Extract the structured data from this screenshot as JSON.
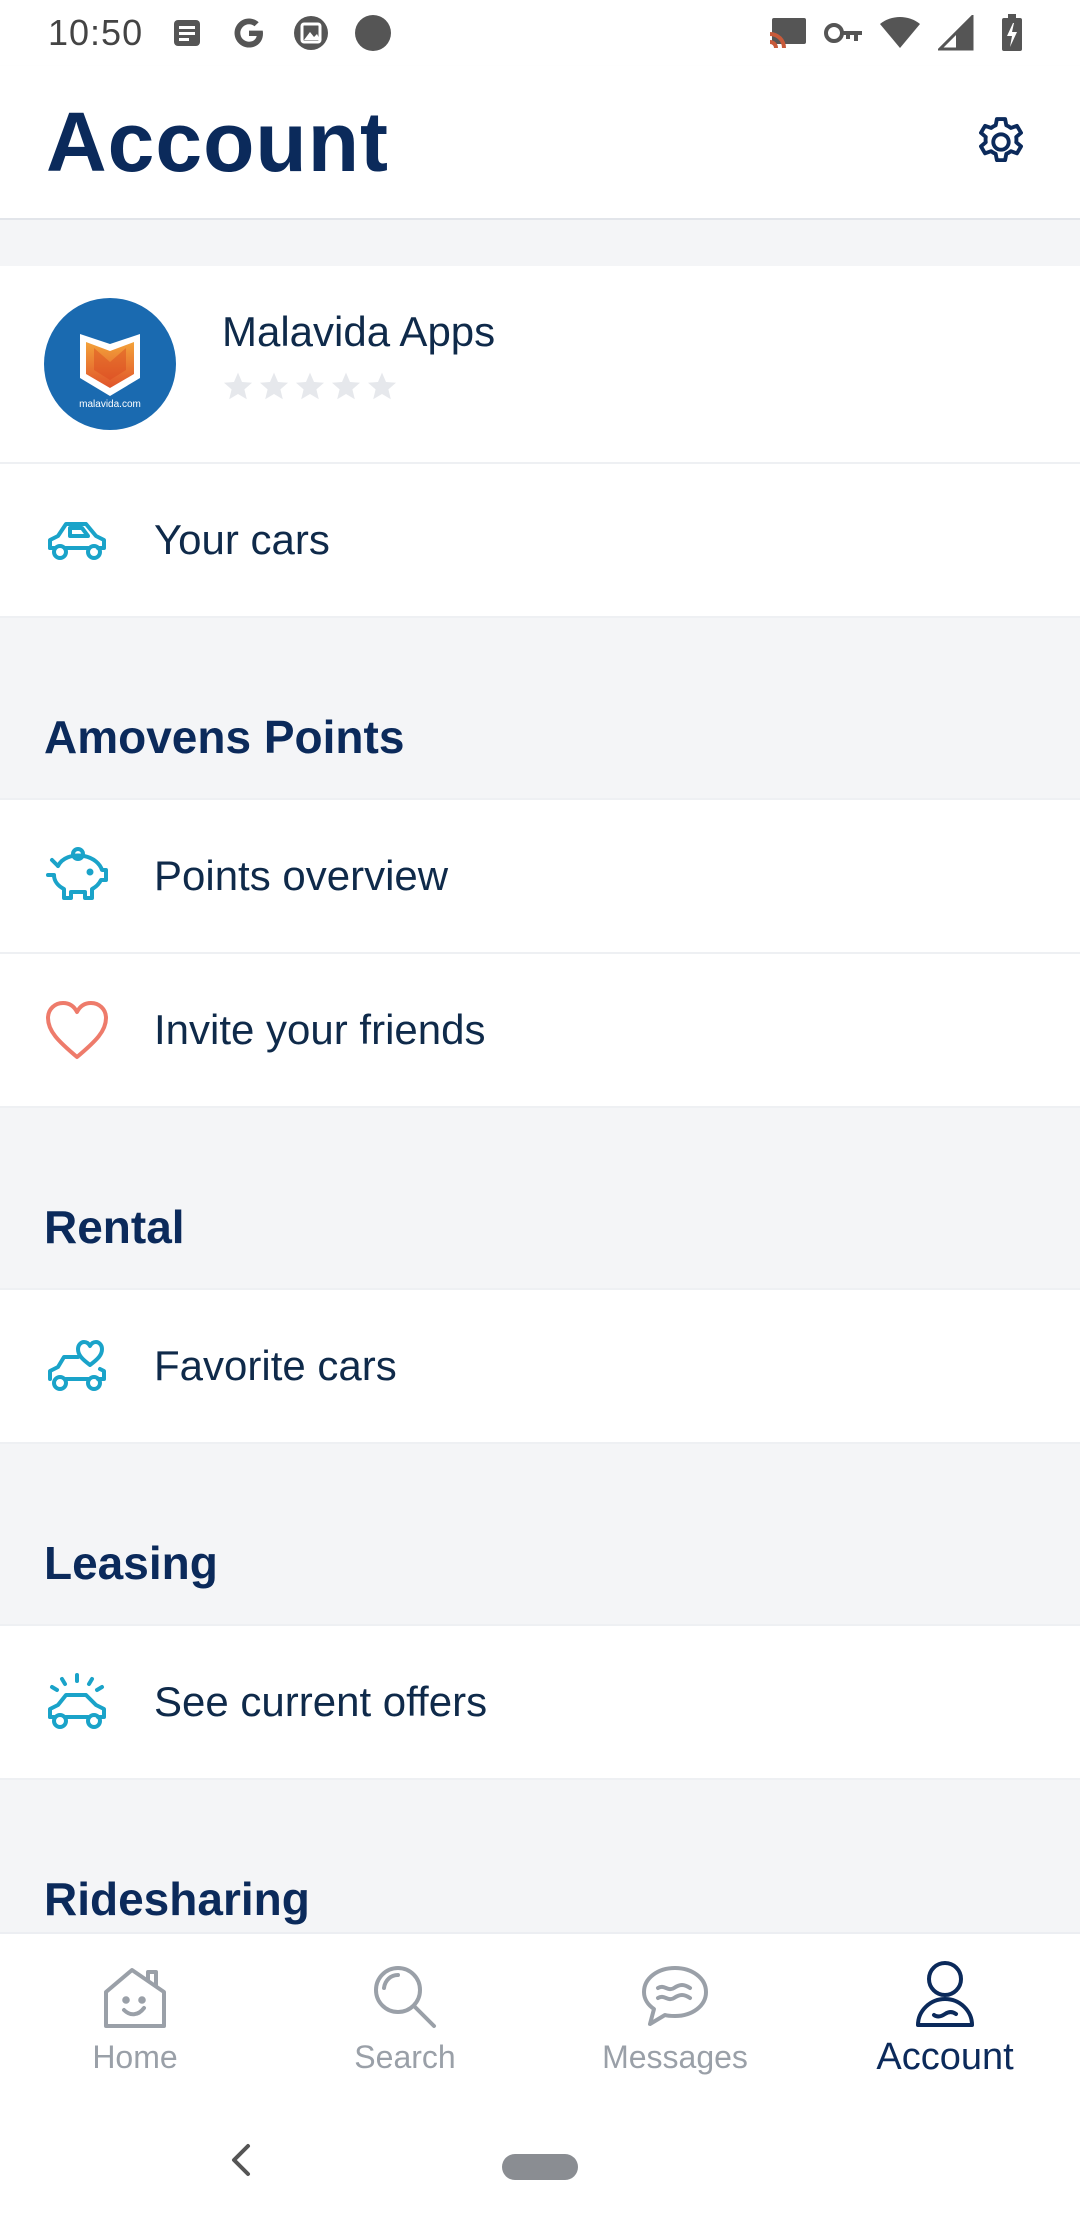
{
  "status_bar": {
    "time": "10:50",
    "left_icons": [
      "news-icon",
      "google-icon",
      "image-icon",
      "dot-icon"
    ],
    "right_icons": [
      "cast-icon",
      "key-icon",
      "wifi-icon",
      "signal-icon",
      "battery-icon"
    ]
  },
  "header": {
    "title": "Account",
    "settings_icon": "gear-icon"
  },
  "profile": {
    "name": "Malavida Apps",
    "avatar_caption": "malavida.com",
    "rating": 0,
    "rating_max": 5
  },
  "menu": {
    "your_cars": "Your cars"
  },
  "sections": {
    "amovens_points": {
      "title": "Amovens Points",
      "items": [
        "Points overview",
        "Invite your friends"
      ]
    },
    "rental": {
      "title": "Rental",
      "items": [
        "Favorite cars"
      ]
    },
    "leasing": {
      "title": "Leasing",
      "items": [
        "See current offers"
      ]
    },
    "ridesharing": {
      "title": "Ridesharing"
    }
  },
  "bottom_nav": {
    "items": [
      "Home",
      "Search",
      "Messages",
      "Account"
    ],
    "active": "Account"
  },
  "colors": {
    "primary_navy": "#0b2a5b",
    "accent_teal": "#1aa3c9",
    "heart_coral": "#ee7b6b",
    "background": "#f4f5f7"
  }
}
